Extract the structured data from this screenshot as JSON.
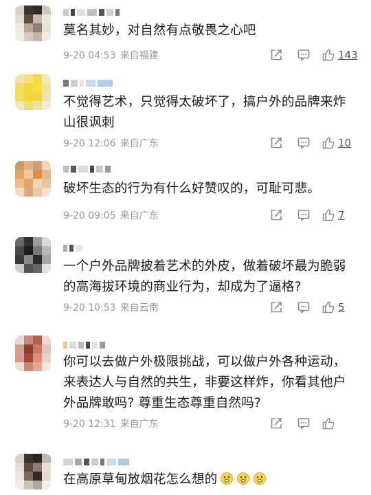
{
  "comments": [
    {
      "text": "莫名其妙，对自然有点敬畏之心吧",
      "time": "9-20 04:53",
      "location": "来自福建",
      "likes": "143"
    },
    {
      "text": "不觉得艺术，只觉得太破坏了，搞户外的品牌来炸山很讽刺",
      "time": "9-20 12:06",
      "location": "来自广东",
      "likes": "10"
    },
    {
      "text": "破坏生态的行为有什么好赞叹的，可耻可悲。",
      "time": "9-20 09:05",
      "location": "来自广东",
      "likes": "7"
    },
    {
      "text": "一个户外品牌披着艺术的外皮，做着破坏最为脆弱的高海拔环境的商业行为，却成为了逼格?",
      "time": "9-20 10:53",
      "location": "来自云南",
      "likes": "5"
    },
    {
      "text": "你可以去做户外极限挑战，可以做户外各种运动，来表达人与自然的共生，非要这样炸，你看其他户外品牌敢吗? 尊重生态尊重自然吗?",
      "time": "9-20 12:31",
      "location": "来自广东",
      "likes": ""
    },
    {
      "text": "在高原草甸放烟花怎么想的",
      "time": "",
      "location": "",
      "likes": ""
    }
  ],
  "colors": {
    "text": "#1a1a1a",
    "meta": "#9a9a9a",
    "icon": "#8a8a8a"
  },
  "icons": [
    "share-icon",
    "comment-icon",
    "like-icon",
    "emoji-icon"
  ]
}
